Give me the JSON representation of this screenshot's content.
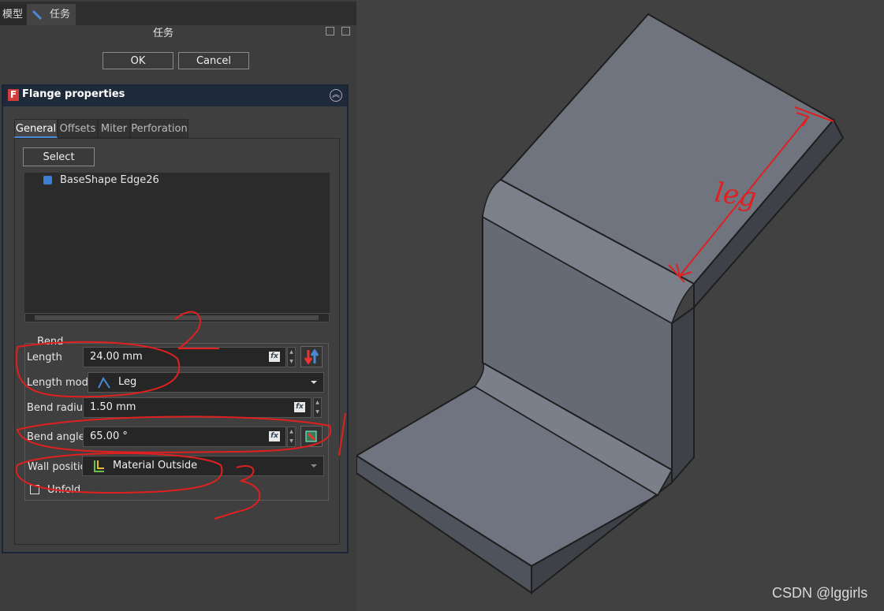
{
  "tabs": {
    "model": "模型",
    "task": "任务"
  },
  "task_title": "任务",
  "buttons": {
    "ok": "OK",
    "cancel": "Cancel"
  },
  "panel": {
    "title": "Flange properties",
    "tabs": [
      "General",
      "Offsets",
      "Miter",
      "Perforation"
    ],
    "select_label": "Select",
    "references": [
      "BaseShape  Edge26"
    ],
    "bend": {
      "group_title": "Bend",
      "length_label": "Length",
      "length_value": "24.00 mm",
      "length_mode_label": "Length mode",
      "length_mode_value": "Leg",
      "bend_radius_label": "Bend radius",
      "bend_radius_value": "1.50 mm",
      "bend_angle_label": "Bend angle",
      "bend_angle_value": "65.00 °",
      "wall_position_label": "Wall positio",
      "wall_position_value": "Material Outside",
      "unfold_label": "Unfold",
      "unfold_checked": false
    }
  },
  "annotations": {
    "leg_text": "leg",
    "numbers": [
      "1",
      "2",
      "3"
    ],
    "color": "#e02020"
  },
  "watermark": "CSDN @lggirls",
  "colors": {
    "accent": "#4a8ad4",
    "panel_header": "#1e2a3a",
    "annotation": "#e02020"
  }
}
